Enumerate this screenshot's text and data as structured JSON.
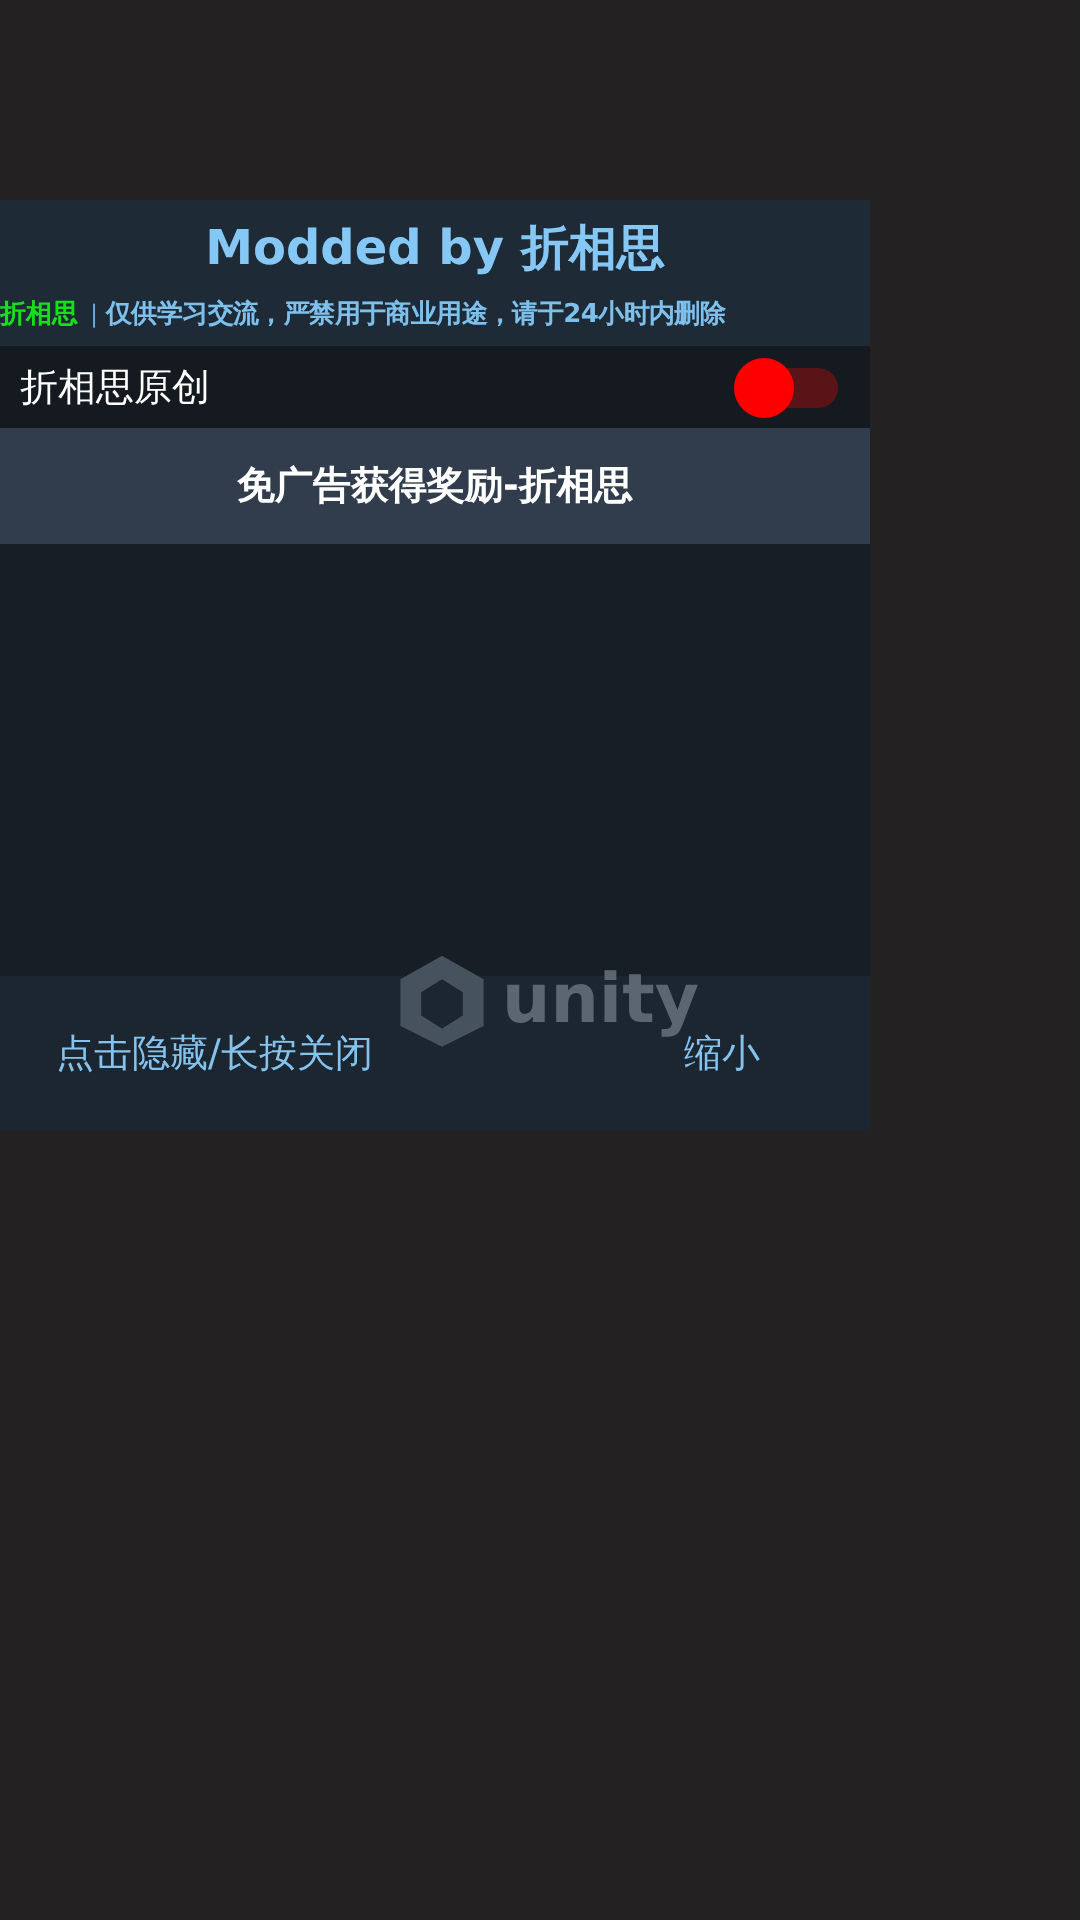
{
  "title": "Modded by 折相思",
  "notice": {
    "author": "折相思",
    "separator": "|",
    "text": "仅供学习交流，严禁用于商业用途，请于24小时内删除"
  },
  "toggles": [
    {
      "label": "折相思原创",
      "on": false
    }
  ],
  "buttons": [
    {
      "label": "免广告获得奖励-折相思"
    }
  ],
  "background_logo": "unity",
  "footer": {
    "hide_close": "点击隐藏/长按关闭",
    "minimize": "缩小"
  }
}
